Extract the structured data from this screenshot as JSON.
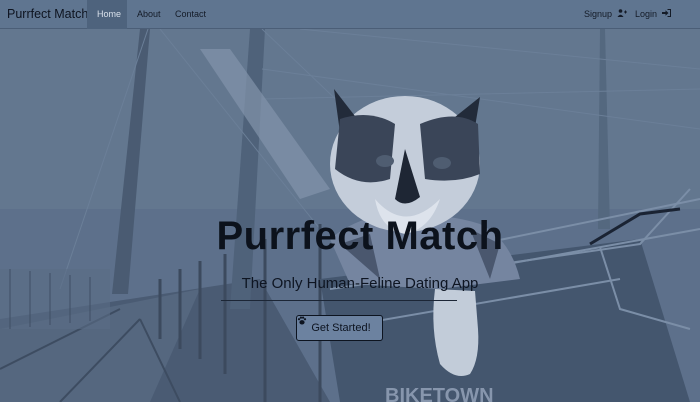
{
  "navbar": {
    "brand": "Purrfect Match",
    "links": [
      {
        "label": "Home",
        "active": true
      },
      {
        "label": "About",
        "active": false
      },
      {
        "label": "Contact",
        "active": false
      }
    ],
    "signup_label": "Signup",
    "signup_icon": "user-plus-icon",
    "login_label": "Login",
    "login_icon": "sign-in-icon"
  },
  "hero": {
    "title": "Purrfect Match",
    "subtitle": "The Only Human-Feline Dating App",
    "cta_label": "Get Started!",
    "cta_icon": "paw-icon",
    "background_description_colors": {
      "overlay": "#51657f",
      "navbar": "#5f7590",
      "button": "#6c82a0"
    }
  }
}
